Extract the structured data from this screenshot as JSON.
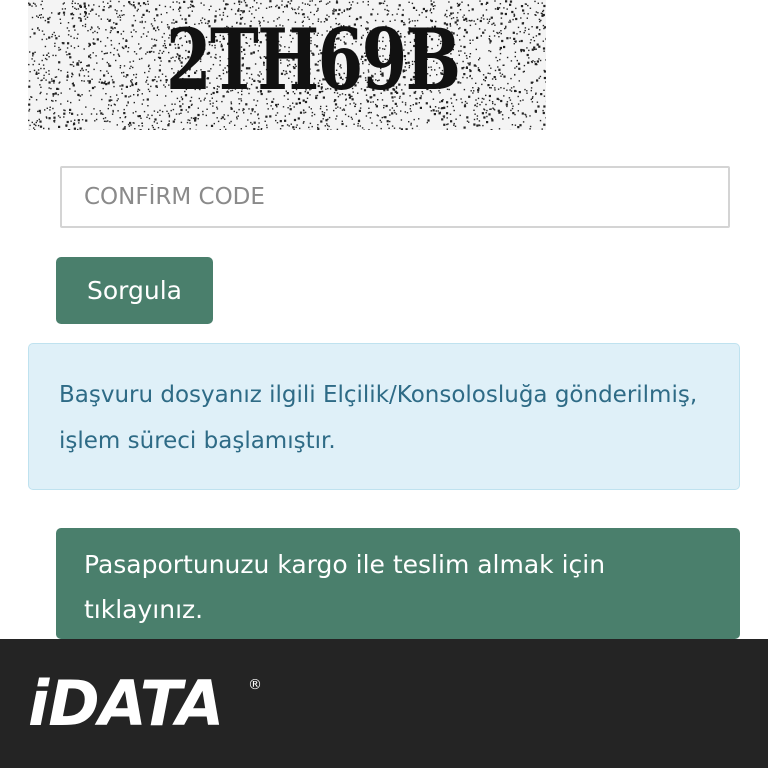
{
  "captcha": {
    "code": "2TH69B"
  },
  "form": {
    "confirm_placeholder": "CONFİRM CODE",
    "submit_label": "Sorgula"
  },
  "status": {
    "message": "Başvuru dosyanız ilgili Elçilik/Konsolosluğa gönderilmiş, işlem süreci başlamıştır."
  },
  "cargo": {
    "link_text": "Pasaportunuzu kargo ile teslim almak için tıklayınız."
  },
  "footer": {
    "logo_text": "iDATA",
    "registered_mark": "®"
  },
  "colors": {
    "primary": "#4a7f6c",
    "info_bg": "#dff0f8",
    "info_text": "#2e6b86",
    "footer_bg": "#242424"
  }
}
